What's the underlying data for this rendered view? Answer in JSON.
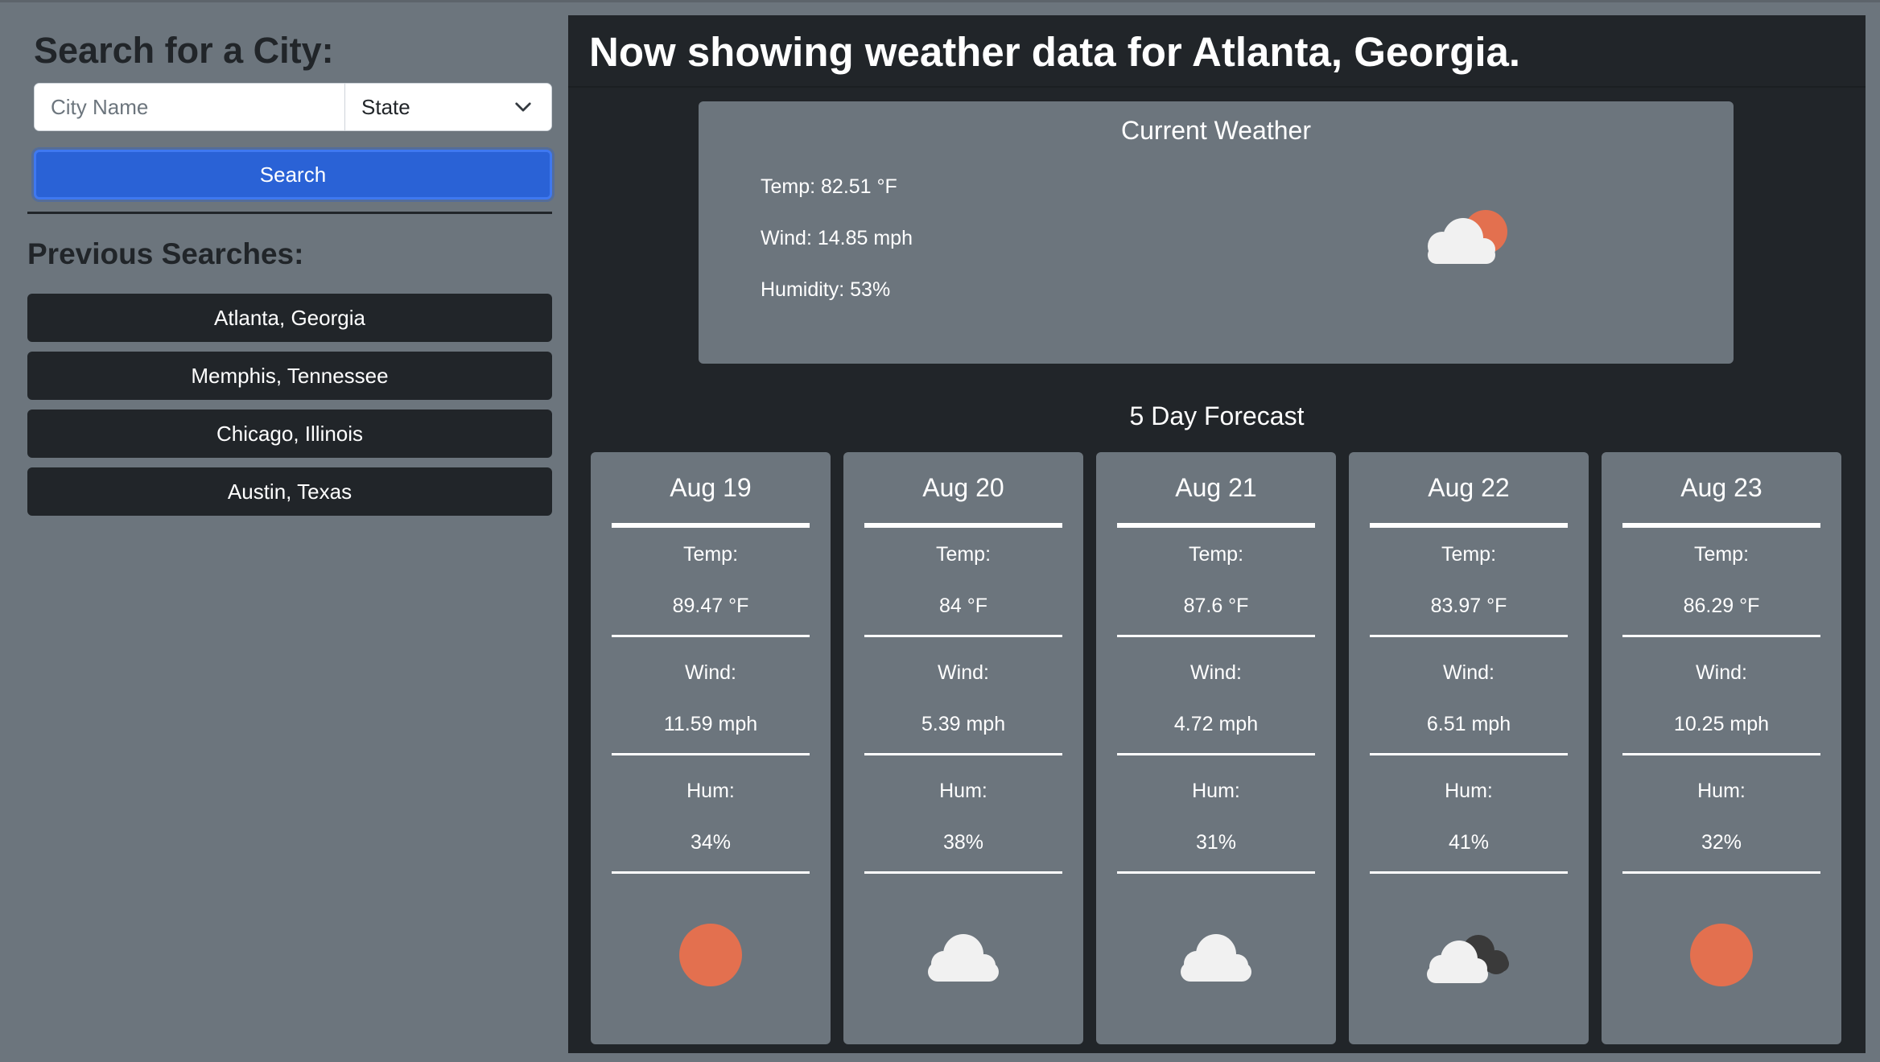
{
  "sidebar": {
    "search_heading": "Search for a City:",
    "city_placeholder": "City Name",
    "state_selected": "State",
    "search_label": "Search",
    "previous_heading": "Previous Searches:",
    "history": [
      "Atlanta, Georgia",
      "Memphis, Tennessee",
      "Chicago, Illinois",
      "Austin, Texas"
    ]
  },
  "main": {
    "title": "Now showing weather data for Atlanta, Georgia.",
    "current": {
      "title": "Current Weather",
      "temp": "Temp: 82.51 °F",
      "wind": "Wind: 14.85 mph",
      "humidity": "Humidity: 53%",
      "icon": "partly-cloudy-sun-icon"
    },
    "forecast_title": "5 Day Forecast",
    "forecast": [
      {
        "date": "Aug 19",
        "temp_label": "Temp:",
        "temp": "89.47 °F",
        "wind_label": "Wind:",
        "wind": "11.59 mph",
        "hum_label": "Hum:",
        "hum": "34%",
        "icon": "sun-icon"
      },
      {
        "date": "Aug 20",
        "temp_label": "Temp:",
        "temp": "84 °F",
        "wind_label": "Wind:",
        "wind": "5.39 mph",
        "hum_label": "Hum:",
        "hum": "38%",
        "icon": "cloud-icon"
      },
      {
        "date": "Aug 21",
        "temp_label": "Temp:",
        "temp": "87.6 °F",
        "wind_label": "Wind:",
        "wind": "4.72 mph",
        "hum_label": "Hum:",
        "hum": "31%",
        "icon": "cloud-icon"
      },
      {
        "date": "Aug 22",
        "temp_label": "Temp:",
        "temp": "83.97 °F",
        "wind_label": "Wind:",
        "wind": "6.51 mph",
        "hum_label": "Hum:",
        "hum": "41%",
        "icon": "broken-clouds-icon"
      },
      {
        "date": "Aug 23",
        "temp_label": "Temp:",
        "temp": "86.29 °F",
        "wind_label": "Wind:",
        "wind": "10.25 mph",
        "hum_label": "Hum:",
        "hum": "32%",
        "icon": "sun-icon"
      }
    ]
  },
  "colors": {
    "page_bg": "#6c757d",
    "panel_bg": "#212529",
    "primary": "#2a62d6",
    "sun": "#e3704f",
    "cloud": "#f1f1f1",
    "dark_cloud": "#3a3a3a"
  }
}
